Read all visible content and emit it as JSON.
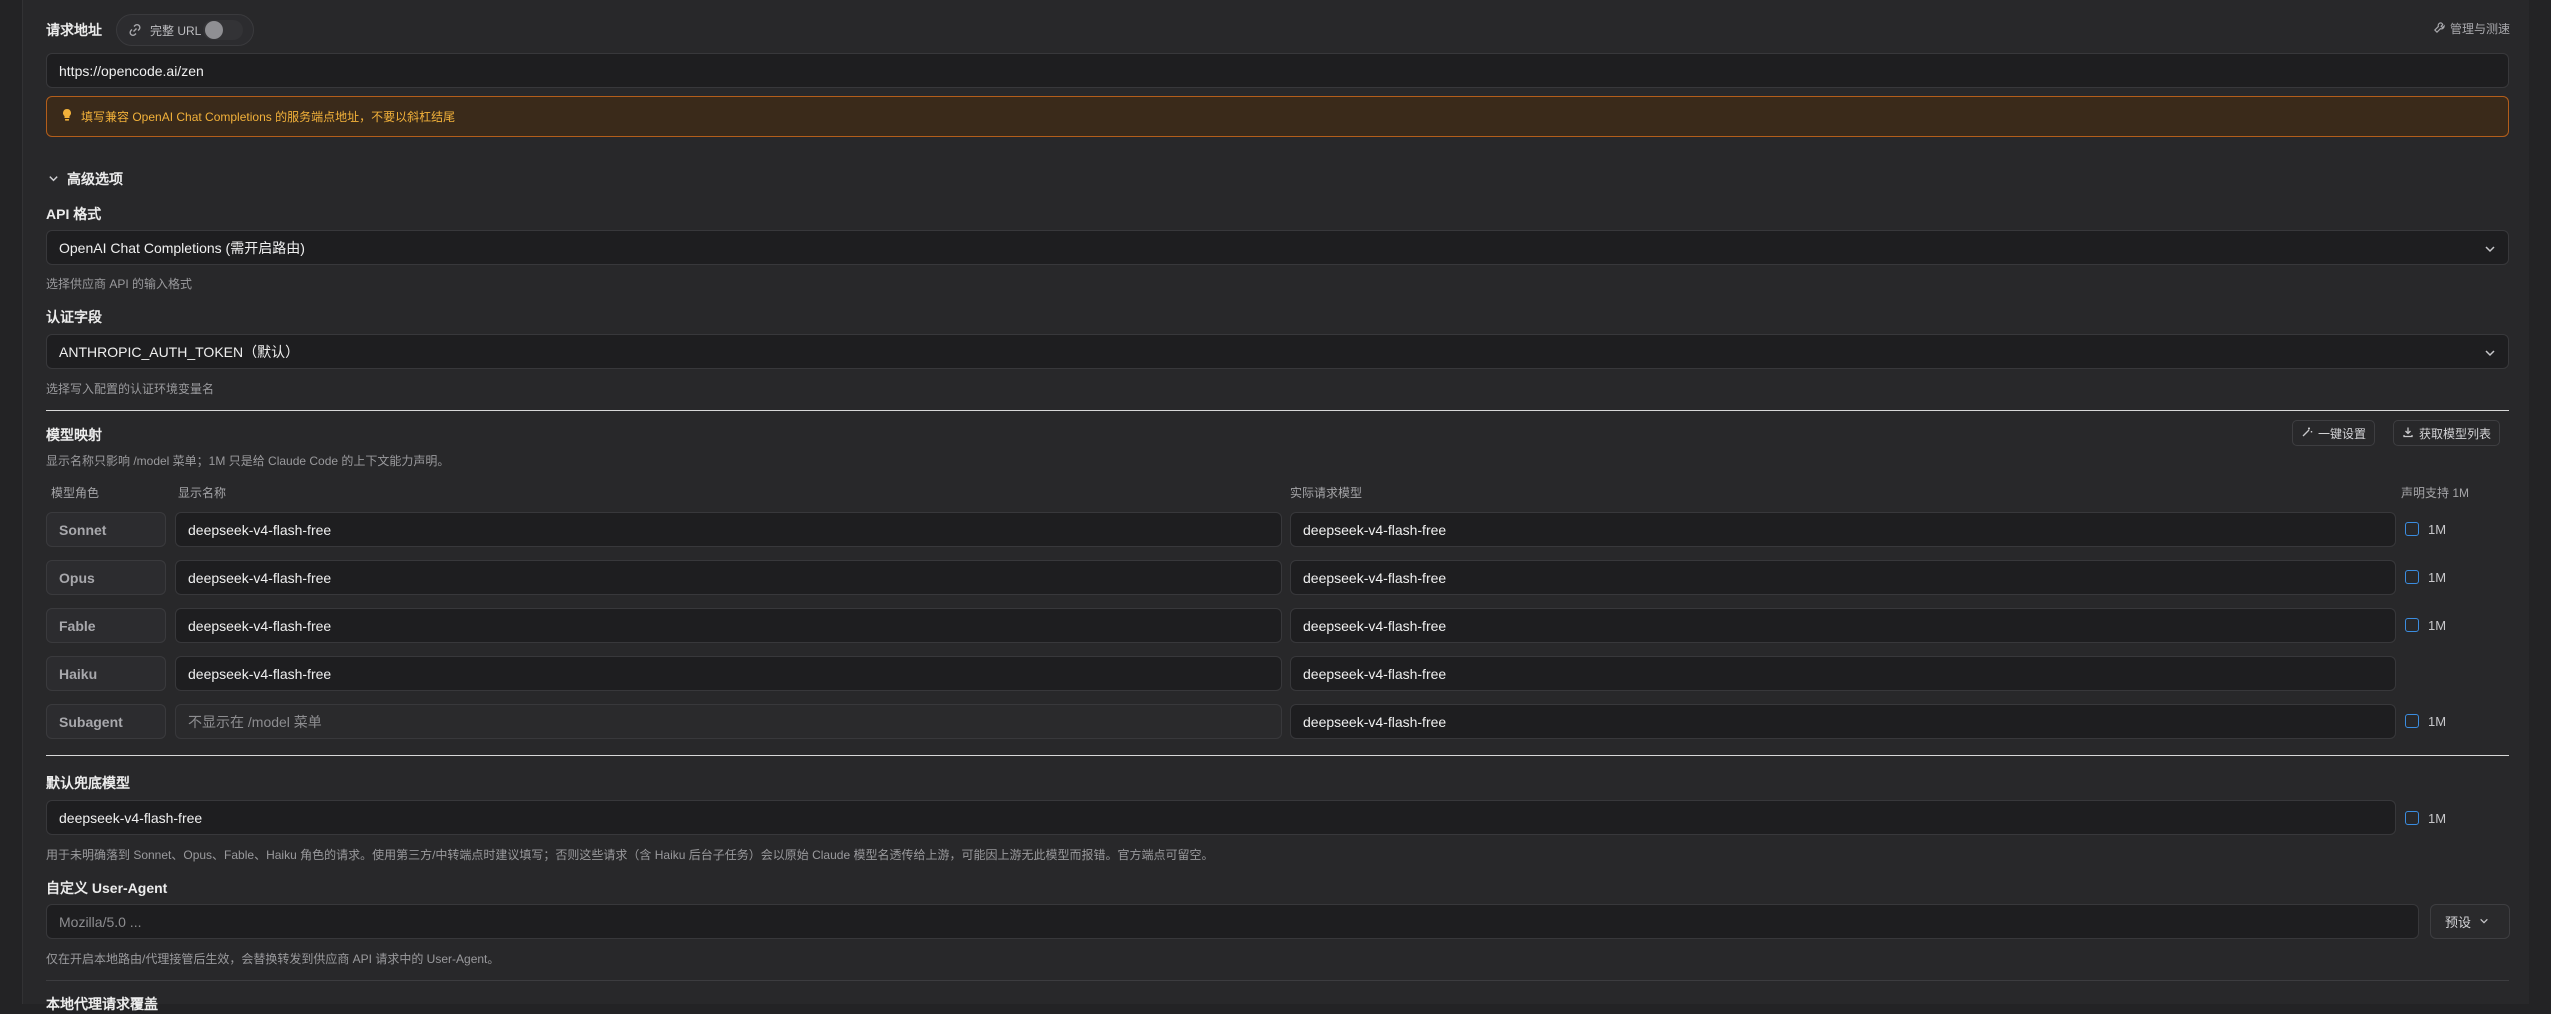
{
  "request_url": {
    "label": "请求地址",
    "full_url_toggle_label": "完整 URL",
    "manage_label": "管理与测速",
    "value": "https://opencode.ai/zen",
    "warning": "填写兼容 OpenAI Chat Completions 的服务端点地址，不要以斜杠结尾"
  },
  "advanced": {
    "title": "高级选项",
    "api_format": {
      "label": "API 格式",
      "value": "OpenAI Chat Completions (需开启路由)",
      "hint": "选择供应商 API 的输入格式"
    },
    "auth_field": {
      "label": "认证字段",
      "value": "ANTHROPIC_AUTH_TOKEN（默认）",
      "hint": "选择写入配置的认证环境变量名"
    }
  },
  "model_mapping": {
    "title": "模型映射",
    "hint": "显示名称只影响 /model 菜单；1M 只是给 Claude Code 的上下文能力声明。",
    "one_click_label": "一键设置",
    "fetch_list_label": "获取模型列表",
    "columns": {
      "role": "模型角色",
      "display_name": "显示名称",
      "actual_model": "实际请求模型",
      "support_1m": "声明支持 1M"
    },
    "rows": [
      {
        "role": "Sonnet",
        "display": "deepseek-v4-flash-free",
        "actual": "deepseek-v4-flash-free",
        "one_m": "1M"
      },
      {
        "role": "Opus",
        "display": "deepseek-v4-flash-free",
        "actual": "deepseek-v4-flash-free",
        "one_m": "1M"
      },
      {
        "role": "Fable",
        "display": "deepseek-v4-flash-free",
        "actual": "deepseek-v4-flash-free",
        "one_m": "1M"
      },
      {
        "role": "Haiku",
        "display": "deepseek-v4-flash-free",
        "actual": "deepseek-v4-flash-free",
        "one_m": ""
      },
      {
        "role": "Subagent",
        "display": "不显示在 /model 菜单",
        "actual": "deepseek-v4-flash-free",
        "one_m": "1M"
      }
    ]
  },
  "fallback_model": {
    "label": "默认兜底模型",
    "value": "deepseek-v4-flash-free",
    "one_m": "1M",
    "hint": "用于未明确落到 Sonnet、Opus、Fable、Haiku 角色的请求。使用第三方/中转端点时建议填写；否则这些请求（含 Haiku 后台子任务）会以原始 Claude 模型名透传给上游，可能因上游无此模型而报错。官方端点可留空。"
  },
  "user_agent": {
    "label": "自定义 User-Agent",
    "placeholder": "Mozilla/5.0 ...",
    "preset_label": "预设",
    "hint": "仅在开启本地路由/代理接管后生效，会替换转发到供应商 API 请求中的 User-Agent。"
  },
  "next_section": {
    "label": "本地代理请求覆盖"
  },
  "colors": {
    "background": "#232325",
    "panel": "#28282a",
    "input_bg": "#1e1e20",
    "warning_border": "#b35e1b",
    "warning_text": "#f2b13a",
    "checkbox_accent": "#3b8de0"
  }
}
